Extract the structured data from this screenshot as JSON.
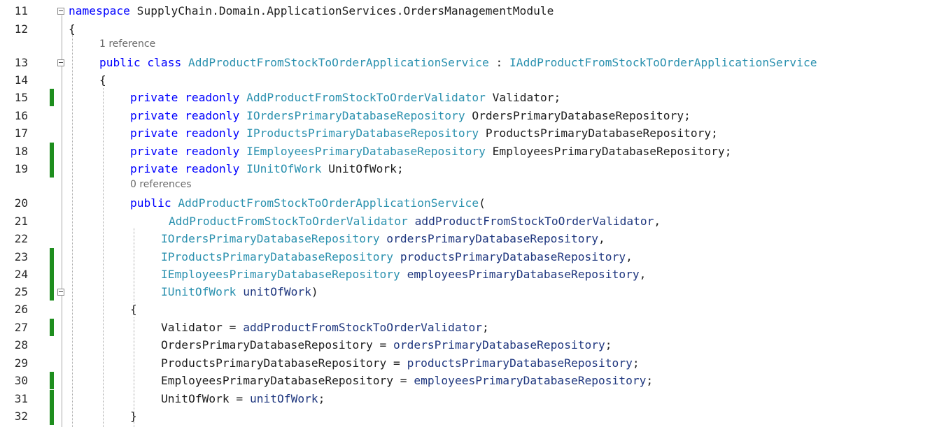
{
  "editor": {
    "lines": [
      {
        "no": "11",
        "indent": 98,
        "tokens": [
          [
            "kw",
            "namespace"
          ],
          [
            "plain",
            " SupplyChain.Domain.ApplicationServices.OrdersManagementModule"
          ]
        ]
      },
      {
        "no": "12",
        "indent": 98,
        "tokens": [
          [
            "plain",
            "{"
          ]
        ]
      },
      {
        "ref": "1 reference"
      },
      {
        "no": "13",
        "indent": 142,
        "tokens": [
          [
            "kw",
            "public"
          ],
          [
            "plain",
            " "
          ],
          [
            "kw",
            "class"
          ],
          [
            "plain",
            " "
          ],
          [
            "ty",
            "AddProductFromStockToOrderApplicationService"
          ],
          [
            "plain",
            " : "
          ],
          [
            "ifc",
            "IAddProductFromStockToOrderApplicationService"
          ]
        ]
      },
      {
        "no": "14",
        "indent": 142,
        "tokens": [
          [
            "plain",
            "{"
          ]
        ]
      },
      {
        "no": "15",
        "indent": 186,
        "tokens": [
          [
            "kw",
            "private"
          ],
          [
            "plain",
            " "
          ],
          [
            "kw",
            "readonly"
          ],
          [
            "plain",
            " "
          ],
          [
            "ty",
            "AddProductFromStockToOrderValidator"
          ],
          [
            "plain",
            " Validator;"
          ]
        ]
      },
      {
        "no": "16",
        "indent": 186,
        "tokens": [
          [
            "kw",
            "private"
          ],
          [
            "plain",
            " "
          ],
          [
            "kw",
            "readonly"
          ],
          [
            "plain",
            " "
          ],
          [
            "ifc",
            "IOrdersPrimaryDatabaseRepository"
          ],
          [
            "plain",
            " OrdersPrimaryDatabaseRepository;"
          ]
        ]
      },
      {
        "no": "17",
        "indent": 186,
        "tokens": [
          [
            "kw",
            "private"
          ],
          [
            "plain",
            " "
          ],
          [
            "kw",
            "readonly"
          ],
          [
            "plain",
            " "
          ],
          [
            "ifc",
            "IProductsPrimaryDatabaseRepository"
          ],
          [
            "plain",
            " ProductsPrimaryDatabaseRepository;"
          ]
        ]
      },
      {
        "no": "18",
        "indent": 186,
        "tokens": [
          [
            "kw",
            "private"
          ],
          [
            "plain",
            " "
          ],
          [
            "kw",
            "readonly"
          ],
          [
            "plain",
            " "
          ],
          [
            "ifc",
            "IEmployeesPrimaryDatabaseRepository"
          ],
          [
            "plain",
            " EmployeesPrimaryDatabaseRepository;"
          ]
        ]
      },
      {
        "no": "19",
        "indent": 186,
        "tokens": [
          [
            "kw",
            "private"
          ],
          [
            "plain",
            " "
          ],
          [
            "kw",
            "readonly"
          ],
          [
            "plain",
            " "
          ],
          [
            "ifc",
            "IUnitOfWork"
          ],
          [
            "plain",
            " UnitOfWork;"
          ]
        ]
      },
      {
        "ref": "0 references"
      },
      {
        "no": "20",
        "indent": 186,
        "tokens": [
          [
            "kw",
            "public"
          ],
          [
            "plain",
            " "
          ],
          [
            "ty",
            "AddProductFromStockToOrderApplicationService"
          ],
          [
            "plain",
            "("
          ]
        ]
      },
      {
        "no": "21",
        "indent": 241,
        "tokens": [
          [
            "ty",
            "AddProductFromStockToOrderValidator"
          ],
          [
            "plain",
            " "
          ],
          [
            "par",
            "addProductFromStockToOrderValidator"
          ],
          [
            "plain",
            ","
          ]
        ]
      },
      {
        "no": "22",
        "indent": 230,
        "tokens": [
          [
            "ifc",
            "IOrdersPrimaryDatabaseRepository"
          ],
          [
            "plain",
            " "
          ],
          [
            "par",
            "ordersPrimaryDatabaseRepository"
          ],
          [
            "plain",
            ","
          ]
        ]
      },
      {
        "no": "23",
        "indent": 230,
        "tokens": [
          [
            "ifc",
            "IProductsPrimaryDatabaseRepository"
          ],
          [
            "plain",
            " "
          ],
          [
            "par",
            "productsPrimaryDatabaseRepository"
          ],
          [
            "plain",
            ","
          ]
        ]
      },
      {
        "no": "24",
        "indent": 230,
        "tokens": [
          [
            "ifc",
            "IEmployeesPrimaryDatabaseRepository"
          ],
          [
            "plain",
            " "
          ],
          [
            "par",
            "employeesPrimaryDatabaseRepository"
          ],
          [
            "plain",
            ","
          ]
        ]
      },
      {
        "no": "25",
        "indent": 230,
        "tokens": [
          [
            "ifc",
            "IUnitOfWork"
          ],
          [
            "plain",
            " "
          ],
          [
            "par",
            "unitOfWork"
          ],
          [
            "plain",
            ")"
          ]
        ]
      },
      {
        "no": "26",
        "indent": 186,
        "tokens": [
          [
            "plain",
            "{"
          ]
        ]
      },
      {
        "no": "27",
        "indent": 230,
        "tokens": [
          [
            "plain",
            "Validator = "
          ],
          [
            "par",
            "addProductFromStockToOrderValidator"
          ],
          [
            "plain",
            ";"
          ]
        ]
      },
      {
        "no": "28",
        "indent": 230,
        "tokens": [
          [
            "plain",
            "OrdersPrimaryDatabaseRepository = "
          ],
          [
            "par",
            "ordersPrimaryDatabaseRepository"
          ],
          [
            "plain",
            ";"
          ]
        ]
      },
      {
        "no": "29",
        "indent": 230,
        "tokens": [
          [
            "plain",
            "ProductsPrimaryDatabaseRepository = "
          ],
          [
            "par",
            "productsPrimaryDatabaseRepository"
          ],
          [
            "plain",
            ";"
          ]
        ]
      },
      {
        "no": "30",
        "indent": 230,
        "tokens": [
          [
            "plain",
            "EmployeesPrimaryDatabaseRepository = "
          ],
          [
            "par",
            "employeesPrimaryDatabaseRepository"
          ],
          [
            "plain",
            ";"
          ]
        ]
      },
      {
        "no": "31",
        "indent": 230,
        "tokens": [
          [
            "plain",
            "UnitOfWork = "
          ],
          [
            "par",
            "unitOfWork"
          ],
          [
            "plain",
            ";"
          ]
        ]
      },
      {
        "no": "32",
        "indent": 186,
        "tokens": [
          [
            "plain",
            "}"
          ]
        ]
      }
    ],
    "changed_lines": [
      "15",
      "18",
      "19",
      "23",
      "24",
      "25",
      "27",
      "30",
      "31",
      "32"
    ],
    "fold_lines": [
      "11",
      "13",
      "25"
    ],
    "colors": {
      "keyword": "#0000ff",
      "type": "#2b91af",
      "parameter": "#1f377f",
      "change_bar": "#1e8e1e"
    }
  }
}
